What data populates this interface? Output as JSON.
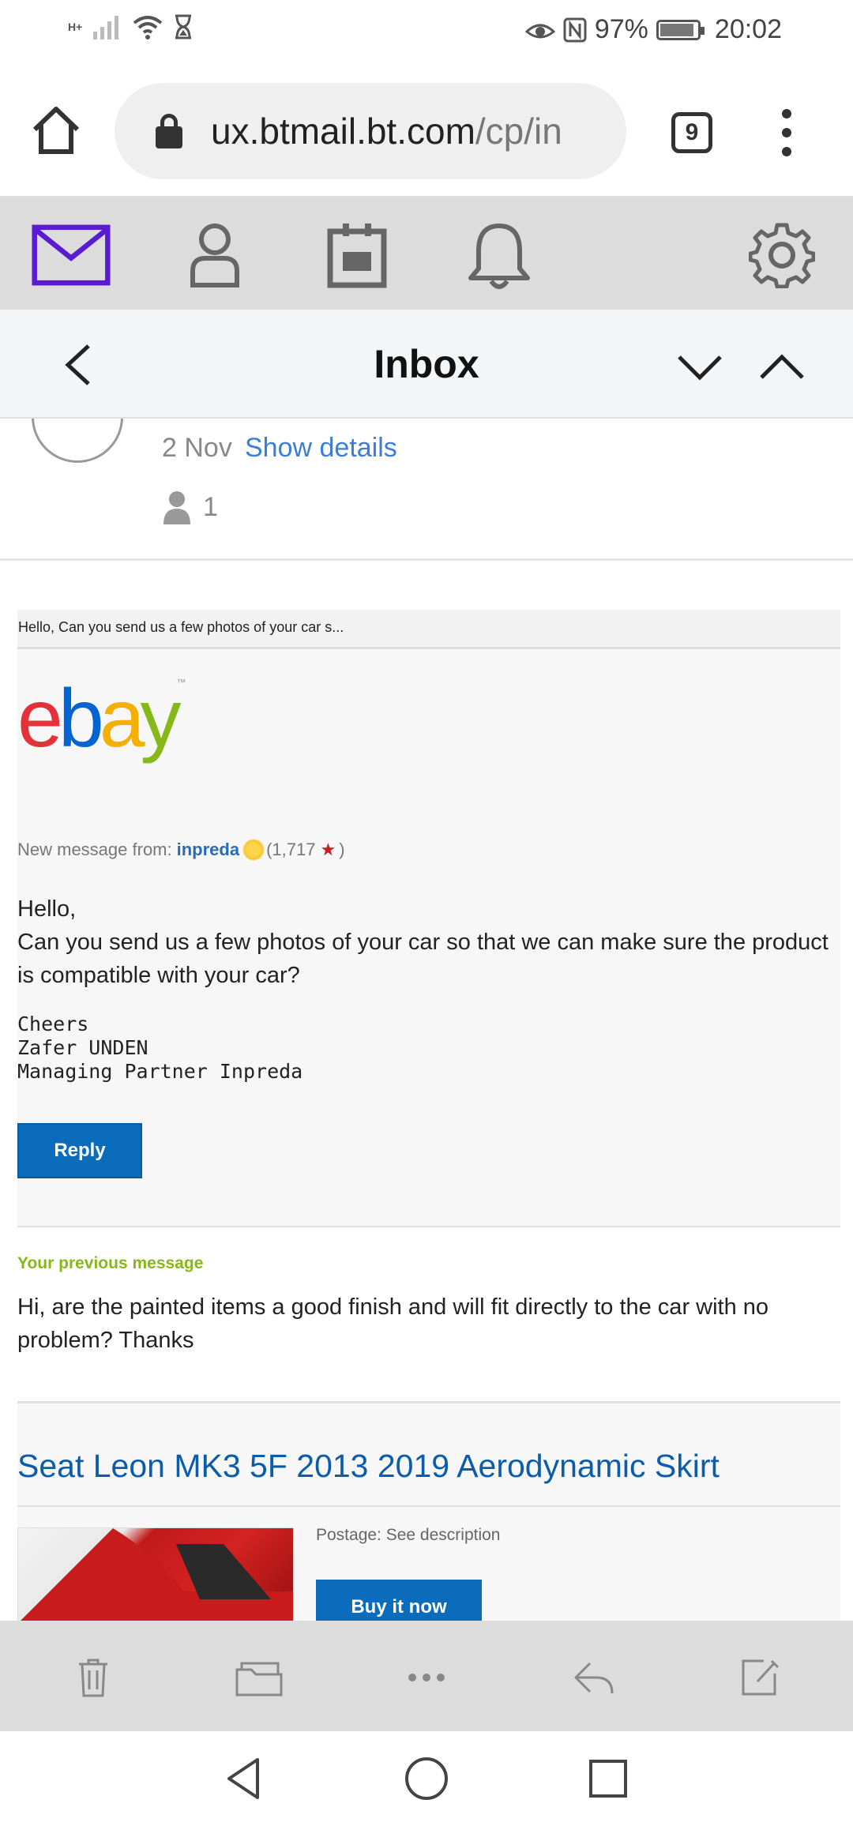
{
  "status": {
    "network": "H+",
    "battery": "97%",
    "time": "20:02"
  },
  "browser": {
    "url_host": "ux.btmail.bt.com",
    "url_path": "/cp/in",
    "tab_count": "9"
  },
  "inbox": {
    "title": "Inbox"
  },
  "message": {
    "date": "2 Nov",
    "show_details": "Show details",
    "recipient_count": "1"
  },
  "email": {
    "preheader": "Hello, Can you send us a few photos of your car s...",
    "logo_e": "e",
    "logo_b": "b",
    "logo_a": "a",
    "logo_y": "y",
    "logo_tm": "™",
    "new_message_label": "New message from:",
    "sender": "inpreda",
    "feedback_open": "(1,717",
    "feedback_close": ")",
    "greeting": "Hello,",
    "body": "Can you send us a few photos of your car so that we can make sure the product is compatible with your car?",
    "signature": "Cheers\nZafer UNDEN\nManaging Partner Inpreda",
    "reply_label": "Reply",
    "previous_title": "Your previous message",
    "previous_text": "Hi, are the painted items a good finish and will fit directly to the car with no problem? Thanks",
    "listing_title": "Seat Leon MK3 5F 2013 2019 Aerodynamic Skirt",
    "postage": "Postage: See description",
    "buy_label": "Buy it now"
  },
  "colors": {
    "accent_purple": "#5b1bd1",
    "link_blue": "#3b7dd8",
    "button_blue": "#0c6cbc",
    "ebay_green": "#86b817"
  },
  "icons": {
    "toolbar": [
      "mail-icon",
      "contacts-icon",
      "calendar-icon",
      "notifications-icon",
      "settings-icon"
    ],
    "actions": [
      "delete-icon",
      "move-folder-icon",
      "more-icon",
      "reply-icon",
      "compose-icon"
    ]
  }
}
